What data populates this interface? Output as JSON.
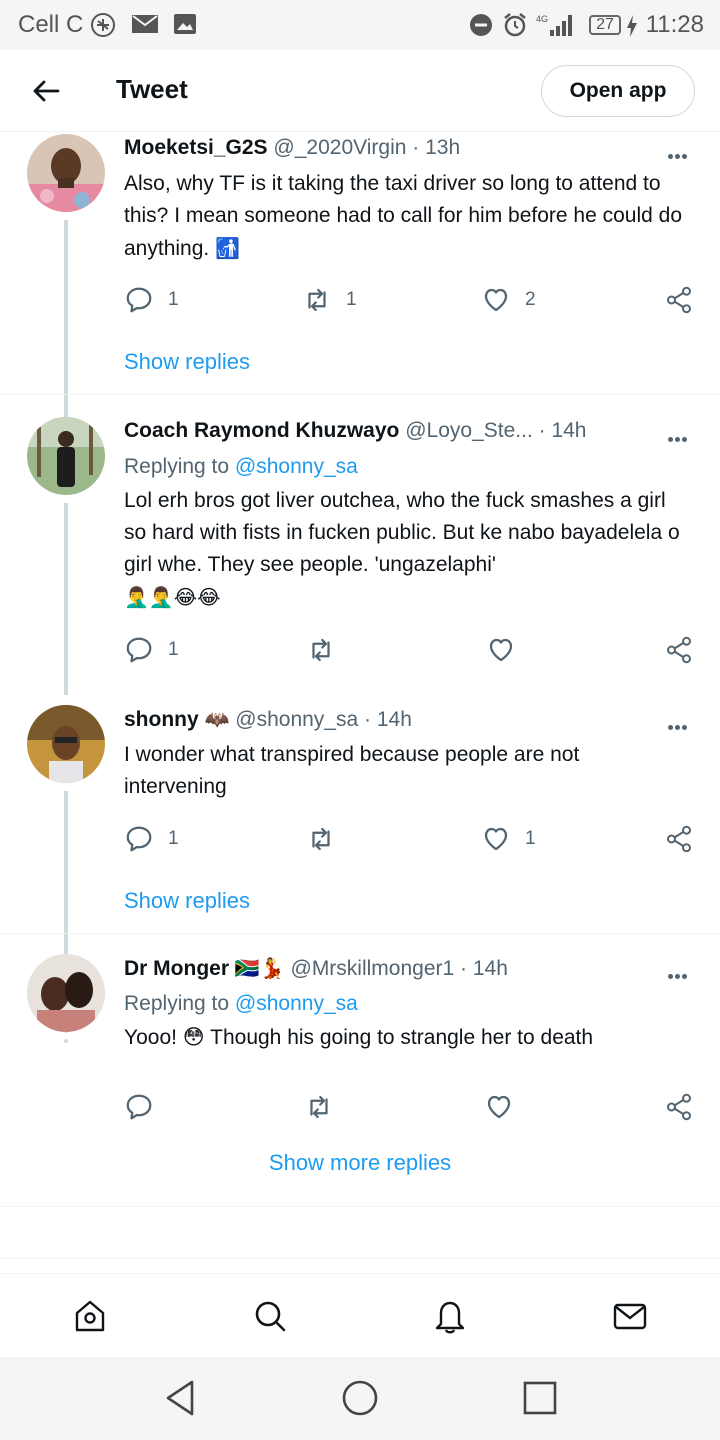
{
  "status_bar": {
    "carrier": "Cell C",
    "battery": "27",
    "time": "11:28",
    "icons": [
      "safari-icon",
      "mail-icon",
      "gallery-icon",
      "dnd-icon",
      "alarm-icon",
      "signal-icon",
      "battery-icon",
      "charging-icon"
    ]
  },
  "header": {
    "title": "Tweet",
    "open_app": "Open app"
  },
  "tweets": [
    {
      "name": "Moeketsi_G2S",
      "handle": "@_2020Virgin",
      "time": "13h",
      "text": "Also, why TF is it taking the taxi driver so long to attend to this? I mean someone had to call for him before he could do anything.",
      "emoji": "🚮",
      "replies": "1",
      "retweets": "1",
      "likes": "2",
      "show_replies": "Show replies"
    },
    {
      "name": "Coach Raymond Khuzwayo",
      "handle": "@Loyo_Ste...",
      "time": "14h",
      "replying_label": "Replying to",
      "replying_to": "@shonny_sa",
      "text": "Lol erh bros got liver outchea, who the fuck smashes a girl so hard with fists in fucken public. But ke nabo bayadelela o girl whe. They see people. 'ungazelaphi'",
      "emoji": "🤦‍♂️🤦‍♂️😂😂",
      "replies": "1",
      "retweets": "",
      "likes": ""
    },
    {
      "name": "shonny",
      "name_emoji": "🦇",
      "handle": "@shonny_sa",
      "time": "14h",
      "text": "I wonder what transpired because people are not intervening",
      "replies": "1",
      "retweets": "",
      "likes": "1",
      "show_replies": "Show replies"
    },
    {
      "name": "Dr Monger",
      "name_emoji": "🇿🇦💃",
      "handle": "@Mrskillmonger1",
      "time": "14h",
      "replying_label": "Replying to",
      "replying_to": "@shonny_sa",
      "text": "Yooo! 😳 Though his going to strangle her to death",
      "replies": "",
      "retweets": "",
      "likes": ""
    }
  ],
  "show_more_replies": "Show more replies",
  "colors": {
    "accent": "#1d9bf0",
    "text": "#0f1419",
    "secondary": "#536471",
    "border": "#cfd9de"
  }
}
